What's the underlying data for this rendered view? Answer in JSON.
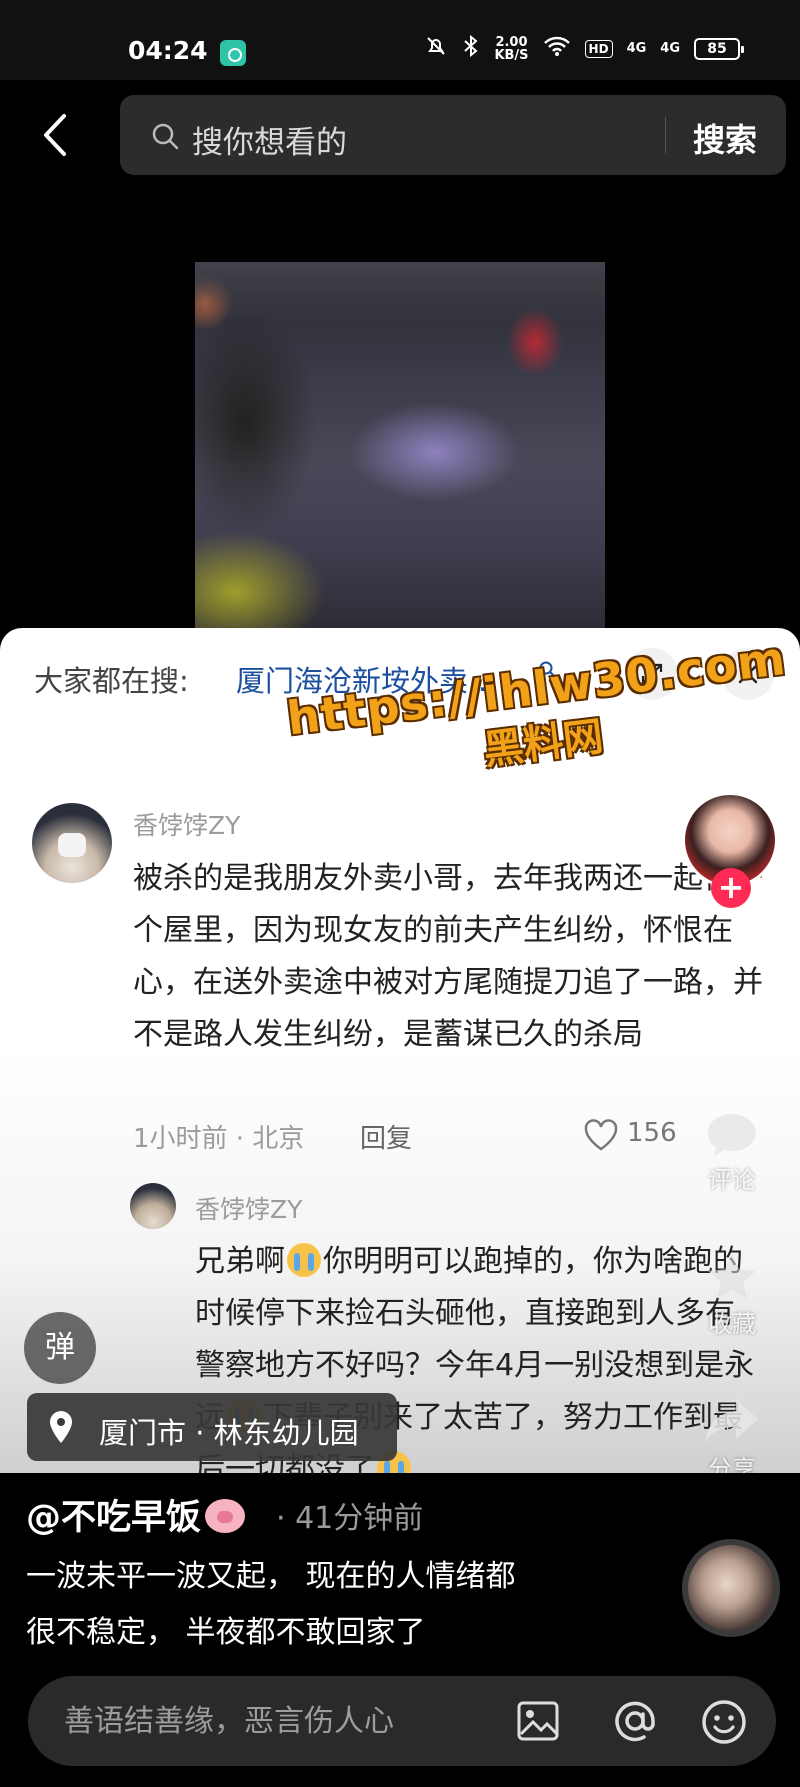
{
  "status_bar": {
    "time": "04:24",
    "speed_value": "2.00",
    "speed_unit": "KB/S",
    "hd_badge": "HD",
    "signal_1": "4G",
    "signal_2": "4G",
    "battery": "85"
  },
  "search": {
    "placeholder": "搜你想看的",
    "button_label": "搜索"
  },
  "comment_panel": {
    "hot_search_label": "大家都在搜:",
    "hot_search_term": "厦门海沧新垵外卖…",
    "comments": [
      {
        "username": "香饽饽ZY",
        "text": "被杀的是我朋友外卖小哥，去年我两还一起住一个屋里，因为现女友的前夫产生纠纷，怀恨在心，在送外卖途中被对方尾随提刀追了一路，并不是路人发生纠纷，是蓄谋已久的杀局",
        "time_location": "1小时前 · 北京",
        "reply_label": "回复",
        "likes": "156",
        "reply": {
          "username": "香饽饽ZY",
          "text_part1": "兄弟啊",
          "text_part2": "你明明可以跑掉的，你为啥跑的时候停下来捡石头砸他，直接跑到人多有警察地方不好吗？今年4月一别没想到是永远",
          "text_part3": "下辈子别来了太苦了，努力工作到最后一切都没了"
        }
      }
    ]
  },
  "watermark": {
    "url": "https://ihlw30.com",
    "name": "黑料网"
  },
  "rail": {
    "comment_label": "评论",
    "favorite_label": "收藏",
    "share_label": "分享"
  },
  "danmaku_label": "弹",
  "location": {
    "text": "厦门市 · 林东幼儿园"
  },
  "post": {
    "author": "@不吃早饭",
    "time": "· 41分钟前",
    "caption_line1": "一波未平一波又起， 现在的人情绪都",
    "caption_line2": "很不稳定， 半夜都不敢回家了"
  },
  "comment_input": {
    "placeholder": "善语结善缘，恶言伤人心"
  },
  "icons": {
    "back": "chevron-left-icon",
    "search": "search-icon",
    "expand": "expand-icon",
    "close": "close-icon",
    "like": "heart-icon",
    "image": "image-icon",
    "at": "at-icon",
    "emoji": "emoji-icon"
  },
  "colors": {
    "hot_search_link": "#1c4fa0",
    "follow_plus": "#ff2b55",
    "watermark": "#f2a219"
  }
}
